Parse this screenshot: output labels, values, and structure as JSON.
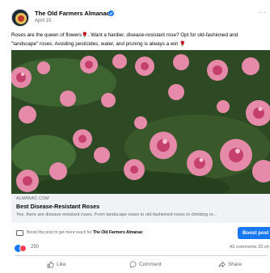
{
  "post": {
    "page_name": "The Old Farmers Almanac",
    "date": "April 15 ·",
    "caption_line1": "Roses are the queen of flowers",
    "caption_line1b": ". Want a hardier, disease-resistant rose? Opt for old-fashioned and",
    "caption_line2": "\"landscape\" roses. Avoiding pesticides, water, and pruning is always a win",
    "more_label": "···"
  },
  "link_preview": {
    "domain": "ALMANAC.COM",
    "title": "Best Disease-Resistant Roses",
    "description": "Yes, there are disease-resistant roses. From landscape roses to old-fashioned roses to climbing ro..."
  },
  "boost": {
    "text_prefix": "Boost this post to get more reach for",
    "text_page": "The Old Farmers Almanac",
    "button_label": "Boost post"
  },
  "engagement": {
    "reaction_count": "250",
    "comments": "43 comments  33 sh"
  },
  "actions": {
    "like": "Like",
    "comment": "Comment",
    "share": "Share"
  },
  "colors": {
    "brand_blue": "#1877f2",
    "love_red": "#f33e58",
    "muted_text": "#65676b"
  }
}
